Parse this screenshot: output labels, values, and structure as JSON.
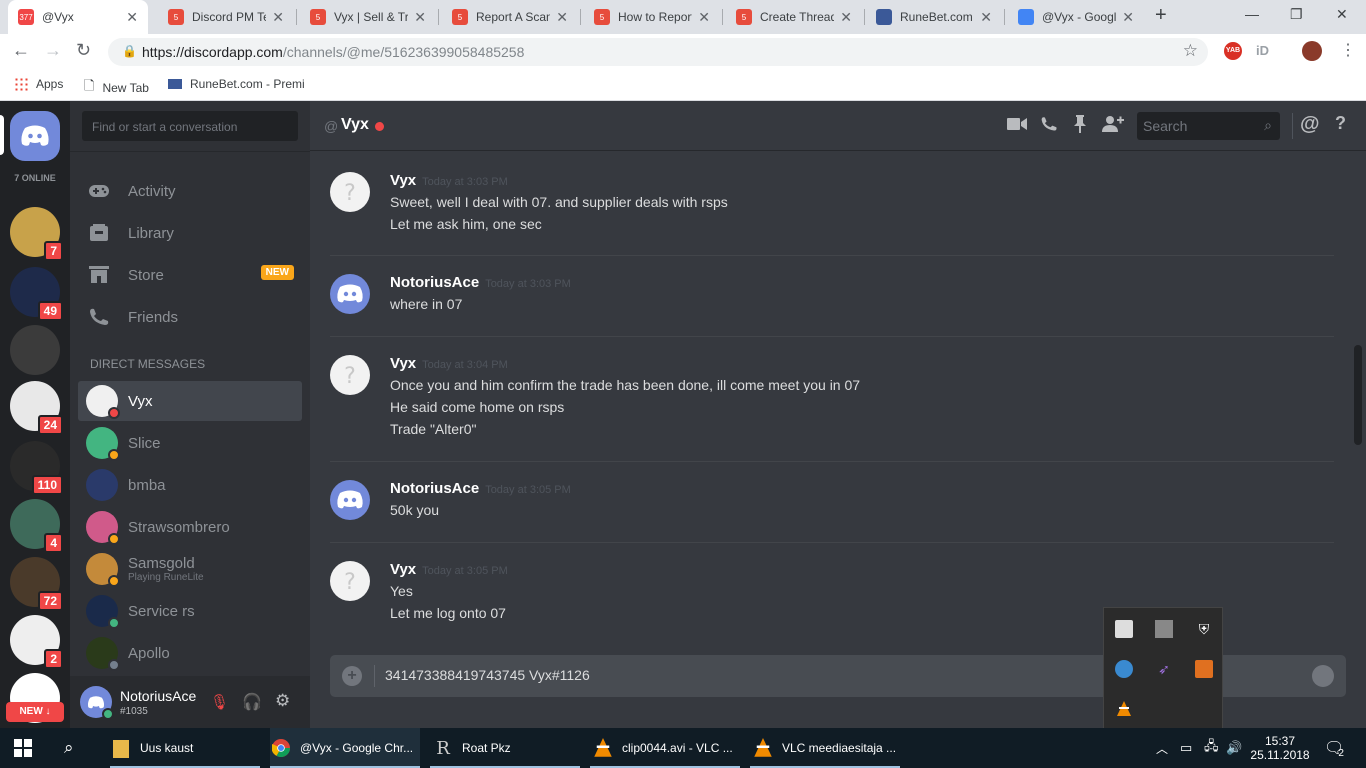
{
  "browser": {
    "tabs": [
      {
        "title": "@Vyx",
        "favicon_text": "377",
        "favicon_color": "#f04747",
        "active": true
      },
      {
        "title": "Discord PM Te",
        "favicon_text": "5",
        "favicon_color": "#e74c3c"
      },
      {
        "title": "Vyx | Sell & Tra",
        "favicon_text": "5",
        "favicon_color": "#e74c3c"
      },
      {
        "title": "Report A Scam",
        "favicon_text": "5",
        "favicon_color": "#e74c3c"
      },
      {
        "title": "How to Report",
        "favicon_text": "5",
        "favicon_color": "#e74c3c"
      },
      {
        "title": "Create Thread",
        "favicon_text": "5",
        "favicon_color": "#e74c3c"
      },
      {
        "title": "RuneBet.com -",
        "favicon_text": "",
        "favicon_color": "#3b5998"
      },
      {
        "title": "@Vyx - Googl",
        "favicon_text": "",
        "favicon_color": "#4285f4"
      }
    ],
    "new_tab_label": "+",
    "url_host": "https://discordapp.com",
    "url_path": "/channels/@me/516236399058485258",
    "bookmarks": {
      "apps": "Apps",
      "new_tab": "New Tab",
      "runebet": "RuneBet.com - Premi"
    },
    "ext_yab": "YAB",
    "ext_id": "iD"
  },
  "guilds": {
    "online_label": "7 ONLINE",
    "items": [
      {
        "badge": "7",
        "color": "#c8a24a"
      },
      {
        "badge": "49",
        "color": "#1e2a4a"
      },
      {
        "badge": "",
        "color": "#3b3b3b"
      },
      {
        "badge": "24",
        "color": "#e8e8e8"
      },
      {
        "badge": "110",
        "color": "#2a2a2a"
      },
      {
        "badge": "4",
        "color": "#3e6a5a"
      },
      {
        "badge": "72",
        "color": "#4a3a2a"
      },
      {
        "badge": "2",
        "color": "#eeeeee"
      },
      {
        "badge": "",
        "color": "#ffffff"
      }
    ],
    "new_label": "NEW ↓"
  },
  "sidebar": {
    "search_placeholder": "Find or start a conversation",
    "nav": [
      {
        "label": "Activity",
        "icon": "gamepad-icon"
      },
      {
        "label": "Library",
        "icon": "library-icon"
      },
      {
        "label": "Store",
        "icon": "store-icon"
      },
      {
        "label": "Friends",
        "icon": "friends-icon"
      }
    ],
    "store_badge": "NEW",
    "dm_header": "DIRECT MESSAGES",
    "dms": [
      {
        "name": "Vyx",
        "sub": "",
        "avatar_color": "#f0f0f0",
        "status": "#f04747",
        "selected": true
      },
      {
        "name": "Slice",
        "sub": "",
        "avatar_color": "#43b581",
        "status": "#faa61a"
      },
      {
        "name": "bmba",
        "sub": "",
        "avatar_color": "#2a3a6a",
        "status": ""
      },
      {
        "name": "Strawsombrero",
        "sub": "",
        "avatar_color": "#d05a8a",
        "status": "#faa61a"
      },
      {
        "name": "Samsgold",
        "sub": "Playing RuneLite",
        "avatar_color": "#c48a3a",
        "status": "#faa61a"
      },
      {
        "name": "Service rs",
        "sub": "",
        "avatar_color": "#1a2a4a",
        "status": "#43b581"
      },
      {
        "name": "Apollo",
        "sub": "",
        "avatar_color": "#2a3a1a",
        "status": "#747f8d"
      }
    ],
    "user": {
      "name": "NotoriusAce",
      "tag": "#1035"
    }
  },
  "chat": {
    "recipient": "Vyx",
    "at": "@",
    "search_placeholder": "Search",
    "messages": [
      {
        "author": "Vyx",
        "time": "Today at 3:03 PM",
        "avatar": "default",
        "lines": [
          "Sweet, well I deal with 07. and supplier deals with rsps",
          "Let me ask him, one sec"
        ]
      },
      {
        "author": "NotoriusAce",
        "time": "Today at 3:03 PM",
        "avatar": "discord",
        "lines": [
          "where in 07"
        ]
      },
      {
        "author": "Vyx",
        "time": "Today at 3:04 PM",
        "avatar": "default",
        "lines": [
          "Once you and him confirm the trade has been done, ill come meet you in 07",
          "He said come home on rsps",
          "Trade \"Alter0\""
        ]
      },
      {
        "author": "NotoriusAce",
        "time": "Today at 3:05 PM",
        "avatar": "discord",
        "lines": [
          "50k you"
        ]
      },
      {
        "author": "Vyx",
        "time": "Today at 3:05 PM",
        "avatar": "default",
        "lines": [
          "Yes",
          "Let me log onto 07"
        ]
      }
    ],
    "composer_text": "341473388419743745 Vyx#1126"
  },
  "taskbar": {
    "items": [
      {
        "label": "Uus kaust",
        "icon": "folder-icon"
      },
      {
        "label": "@Vyx - Google Chr...",
        "icon": "chrome-icon"
      },
      {
        "label": "Roat Pkz",
        "icon": "roat-icon"
      },
      {
        "label": "clip0044.avi - VLC ...",
        "icon": "vlc-icon"
      },
      {
        "label": "VLC meediaesitaja ...",
        "icon": "vlc-icon"
      }
    ],
    "time": "15:37",
    "date": "25.11.2018",
    "notif_count": "2"
  },
  "colors": {
    "blurple": "#7289da",
    "danger": "#f04747"
  }
}
